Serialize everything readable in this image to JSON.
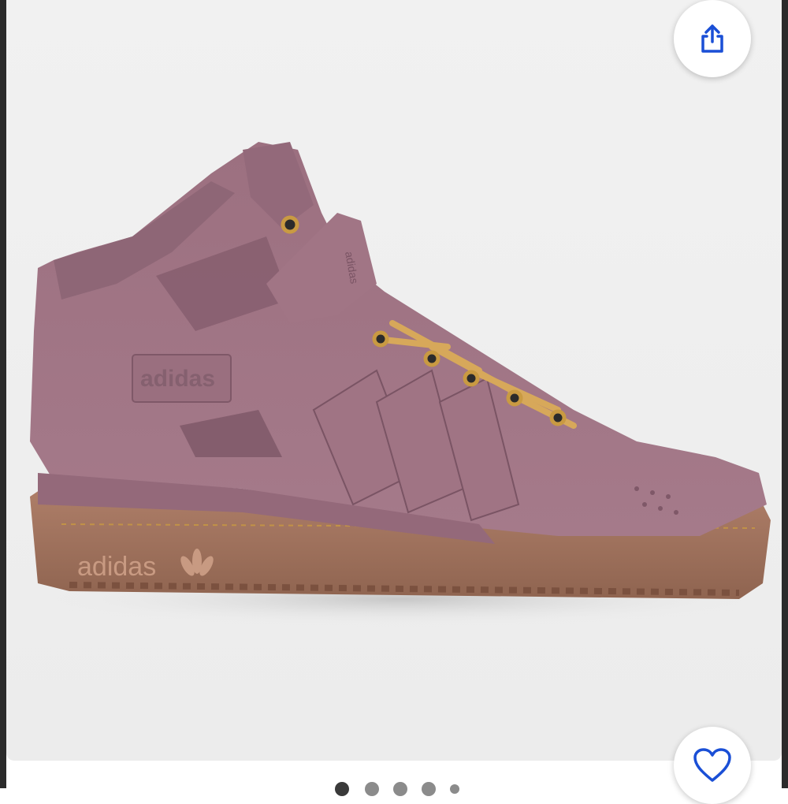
{
  "product": {
    "image_name": "adidas Forum Mid suede sneaker",
    "brand_mark_text": "adidas",
    "colors": {
      "suede": "#a57a8a",
      "suede_dark": "#8c6272",
      "sole": "#a4755f",
      "laces": "#d7a85a",
      "eyelets": "#c99a42"
    }
  },
  "actions": {
    "share_icon": "share-icon",
    "favorite_icon": "heart-icon",
    "accent": "#1a4fd6"
  },
  "pager": {
    "total_visible": 5,
    "active_index": 0
  }
}
